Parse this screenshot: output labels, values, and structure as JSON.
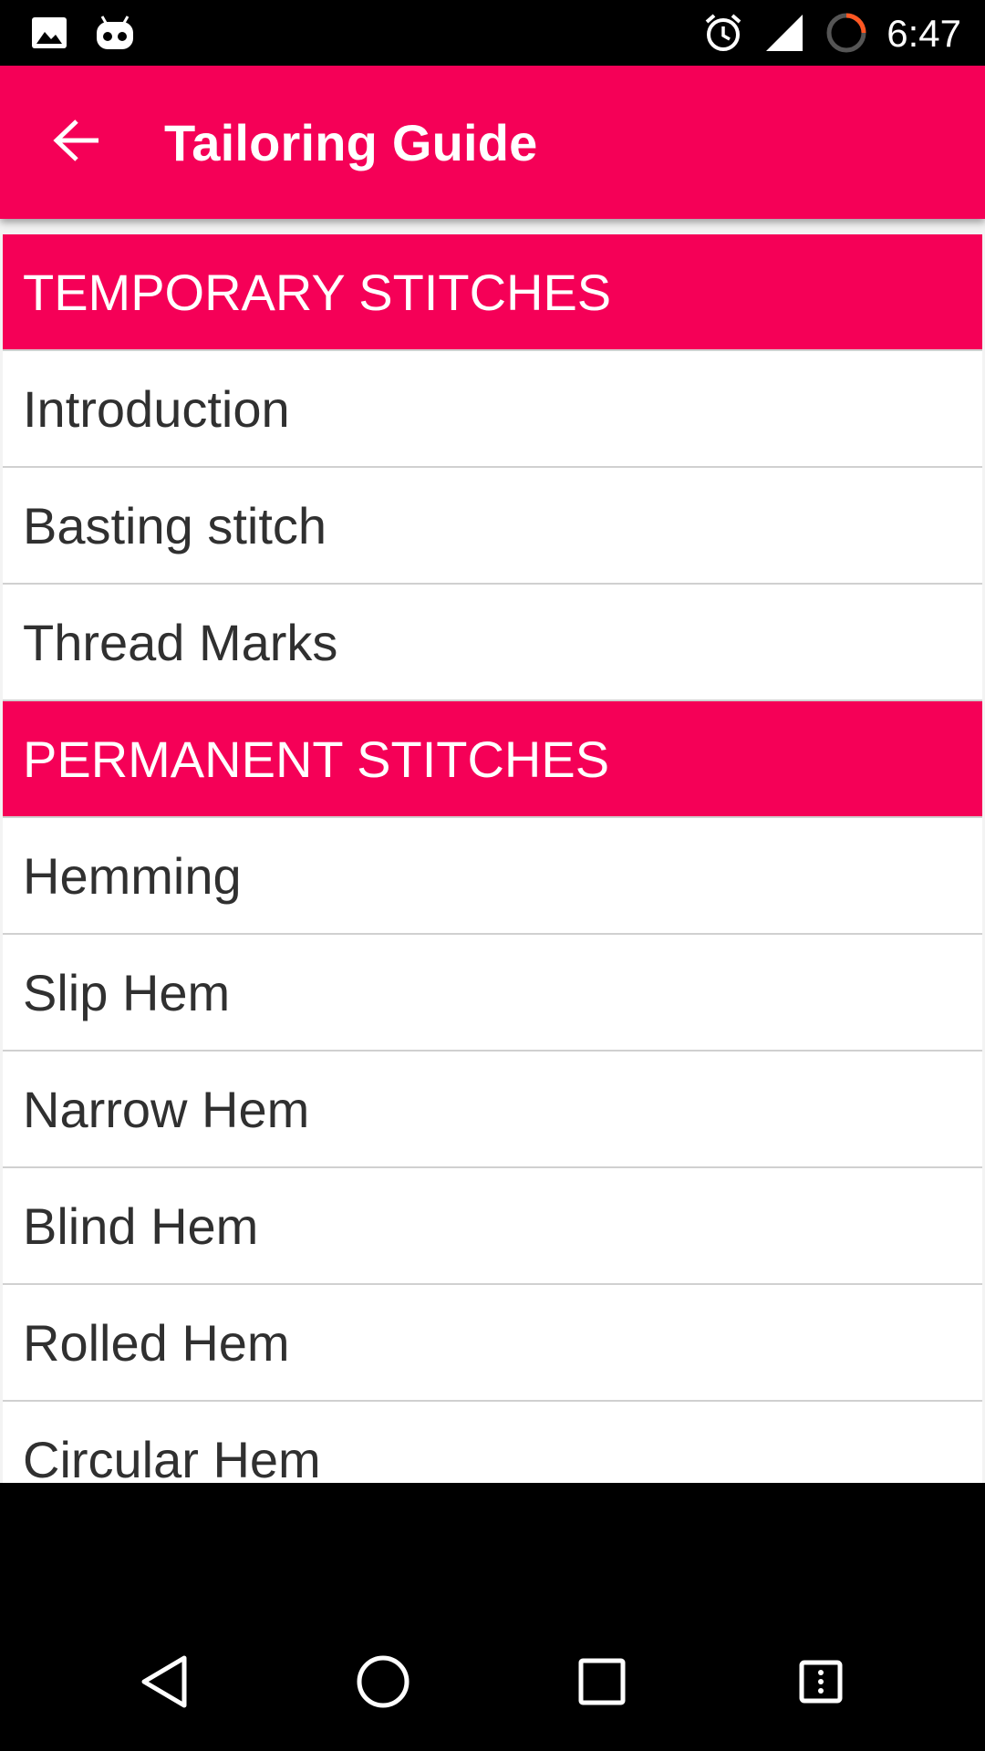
{
  "status_bar": {
    "time": "6:47",
    "icons": [
      "image-icon",
      "android-debug-icon",
      "alarm-icon",
      "cell-signal-icon",
      "sync-progress-icon"
    ]
  },
  "app_bar": {
    "title": "Tailoring Guide",
    "back_icon": "arrow-back-icon"
  },
  "list": {
    "sections": [
      {
        "header": "TEMPORARY STITCHES",
        "items": [
          "Introduction",
          "Basting stitch",
          "Thread Marks"
        ]
      },
      {
        "header": "PERMANENT STITCHES",
        "items": [
          "Hemming",
          "Slip Hem",
          "Narrow Hem",
          "Blind Hem",
          "Rolled Hem",
          "Circular Hem"
        ]
      }
    ]
  },
  "nav_bar": {
    "buttons": [
      "back-triangle-icon",
      "home-circle-icon",
      "recents-square-icon",
      "menu-icon"
    ]
  },
  "colors": {
    "accent": "#f50057",
    "text": "#303030",
    "divider": "#d0d0d0"
  }
}
